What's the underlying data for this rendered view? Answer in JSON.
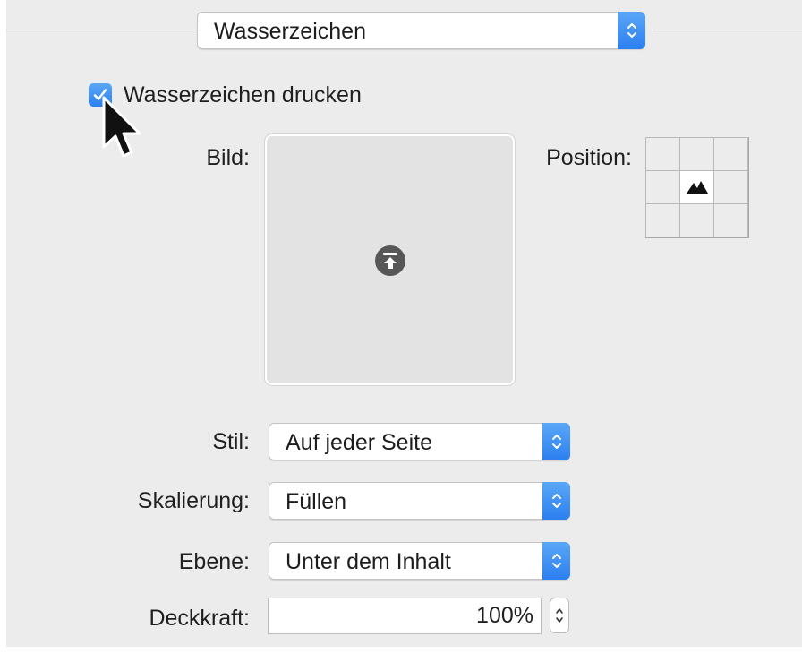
{
  "header": {
    "popup_value": "Wasserzeichen"
  },
  "print_watermark": {
    "label": "Wasserzeichen drucken",
    "checked": true
  },
  "image": {
    "label": "Bild:",
    "icon": "upload-icon"
  },
  "position": {
    "label": "Position:",
    "selected_cell": "middle-center",
    "icon": "mountain-icon"
  },
  "style": {
    "label": "Stil:",
    "value": "Auf jeder Seite"
  },
  "scaling": {
    "label": "Skalierung:",
    "value": "Füllen"
  },
  "layer": {
    "label": "Ebene:",
    "value": "Unter dem Inhalt"
  },
  "opacity": {
    "label": "Deckkraft:",
    "value": "100%"
  },
  "colors": {
    "accent": "#2c7ff0",
    "panel": "#ececec"
  }
}
